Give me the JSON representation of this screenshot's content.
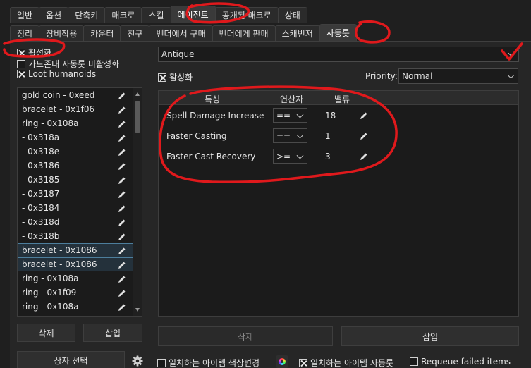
{
  "top_tabs": [
    "일반",
    "옵션",
    "단축키",
    "매크로",
    "스킬",
    "에이전트",
    "공개된 매크로",
    "상태"
  ],
  "sub_tabs": [
    "정리",
    "장비착용",
    "카운터",
    "친구",
    "벤더에서 구매",
    "벤더에게 판매",
    "스캐빈저",
    "자동룻"
  ],
  "left": {
    "enable_label": "활성화",
    "corpse_label": "가드존내 자동룻 비활성화",
    "loot_humanoids_label": "Loot humanoids",
    "items": [
      "gold coin - 0xeed",
      "bracelet - 0x1f06",
      "ring - 0x108a",
      " - 0x318a",
      " - 0x318e",
      " - 0x3186",
      " - 0x3185",
      " - 0x3187",
      " - 0x3184",
      " - 0x318d",
      " - 0x318b",
      "bracelet - 0x1086",
      "bracelet - 0x1086",
      "ring - 0x108a",
      "ring - 0x1f09",
      "ring - 0x108a"
    ],
    "delete_button": "삭제",
    "insert_button": "삽입",
    "box_select_button": "상자 선택"
  },
  "right": {
    "item_combo": "Antique",
    "enable_label": "활성화",
    "priority_label": "Priority:",
    "priority_value": "Normal",
    "headers": {
      "property": "특성",
      "operator": "연산자",
      "value": "밸류"
    },
    "rows": [
      {
        "property": "Spell Damage Increase",
        "operator": "==",
        "value": "18"
      },
      {
        "property": "Faster Casting",
        "operator": "==",
        "value": "1"
      },
      {
        "property": "Faster Cast Recovery",
        "operator": ">=",
        "value": "3"
      }
    ],
    "delete_button": "삭제",
    "insert_button": "삽입"
  },
  "bottom": {
    "color_change_label": "일치하는 아이템 색상변경",
    "auto_loot_label": "일치하는 아이템 자동룻",
    "requeue_label": "Requeue failed items"
  },
  "colors": {
    "annotation": "#e0191c",
    "selection_outline": "#4d7e9c"
  }
}
